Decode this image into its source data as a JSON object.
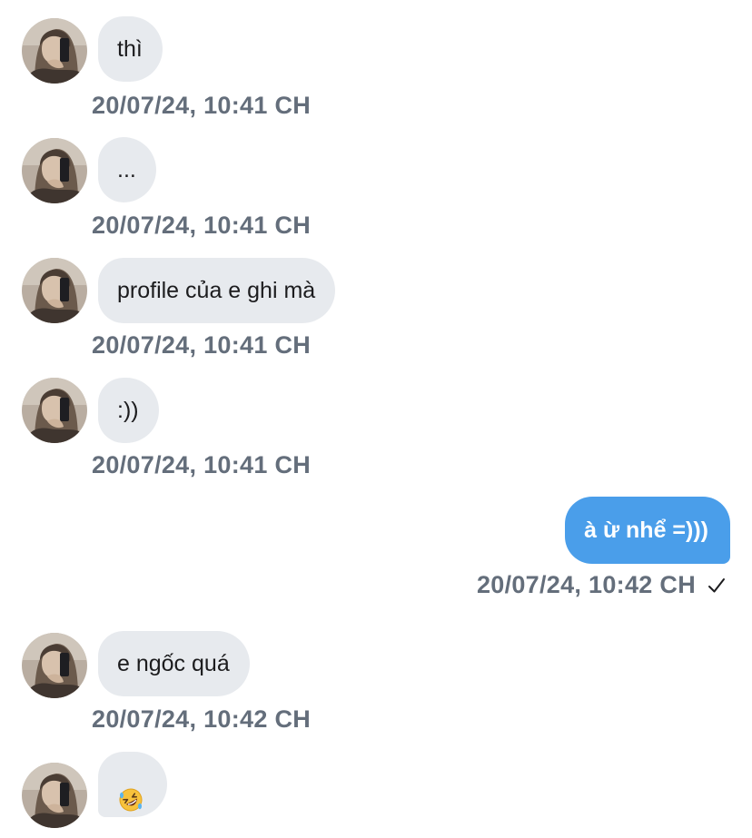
{
  "thread": {
    "incoming": [
      {
        "text": "thì",
        "timestamp": "20/07/24, 10:41 CH"
      },
      {
        "text": "...",
        "timestamp": "20/07/24, 10:41 CH"
      },
      {
        "text": "profile của e ghi mà",
        "timestamp": "20/07/24, 10:41 CH"
      },
      {
        "text": ":))",
        "timestamp": "20/07/24, 10:41 CH"
      },
      {
        "text": "e ngốc quá",
        "timestamp": "20/07/24, 10:42 CH"
      },
      {
        "text": "",
        "emoji": "rolling-on-floor-laughing-emoji"
      }
    ],
    "outgoing": {
      "text": "à ừ nhể =)))",
      "timestamp": "20/07/24, 10:42 CH",
      "status_icon": "check-icon"
    }
  },
  "colors": {
    "incoming_bubble": "#e7eaee",
    "outgoing_bubble": "#4a9eea",
    "timestamp": "#646e7b",
    "text": "#1c1c1e"
  }
}
